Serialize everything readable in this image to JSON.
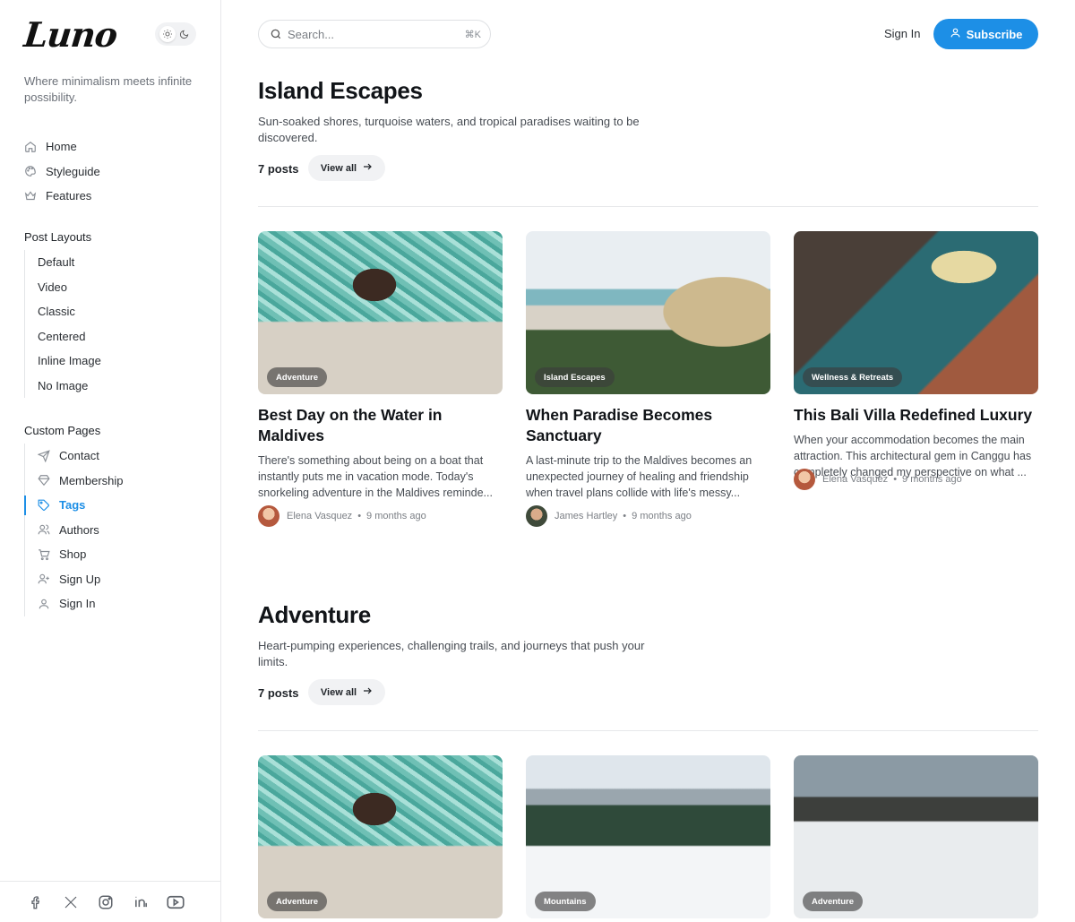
{
  "app": {
    "logo_text": "Luno",
    "tagline": "Where minimalism meets infinite possibility."
  },
  "sidebar": {
    "nav": [
      {
        "label": "Home",
        "icon": "home-icon"
      },
      {
        "label": "Styleguide",
        "icon": "palette-icon"
      },
      {
        "label": "Features",
        "icon": "crown-icon"
      }
    ],
    "post_layouts_heading": "Post Layouts",
    "post_layouts": [
      "Default",
      "Video",
      "Classic",
      "Centered",
      "Inline Image",
      "No Image"
    ],
    "custom_pages_heading": "Custom Pages",
    "custom_pages": [
      {
        "label": "Contact",
        "icon": "send-icon"
      },
      {
        "label": "Membership",
        "icon": "diamond-icon"
      },
      {
        "label": "Tags",
        "icon": "tag-icon",
        "active": true
      },
      {
        "label": "Authors",
        "icon": "users-icon"
      },
      {
        "label": "Shop",
        "icon": "cart-icon"
      },
      {
        "label": "Sign Up",
        "icon": "user-plus-icon"
      },
      {
        "label": "Sign In",
        "icon": "user-icon"
      }
    ],
    "social": [
      "facebook-icon",
      "x-icon",
      "instagram-icon",
      "linkedin-icon",
      "youtube-icon"
    ]
  },
  "header": {
    "search_placeholder": "Search...",
    "search_shortcut": "⌘K",
    "signin_label": "Sign In",
    "subscribe_label": "Subscribe"
  },
  "sections": [
    {
      "title": "Island Escapes",
      "description": "Sun-soaked shores, turquoise waters, and tropical paradises waiting to be discovered.",
      "posts_count": "7 posts",
      "view_all_label": "View all",
      "cards": [
        {
          "badge": "Adventure",
          "title": "Best Day on the Water in Maldives",
          "excerpt": "There's something about being on a boat that instantly puts me in vacation mode. Today's snorkeling adventure in the Maldives reminde...",
          "author": "Elena Vasquez",
          "time": "9 months ago"
        },
        {
          "badge": "Island Escapes",
          "title": "When Paradise Becomes Sanctuary",
          "excerpt": "A last-minute trip to the Maldives becomes an unexpected journey of healing and friendship when travel plans collide with life's messy...",
          "author": "James Hartley",
          "time": "9 months ago"
        },
        {
          "badge": "Wellness & Retreats",
          "title": "This Bali Villa Redefined Luxury",
          "excerpt": "When your accommodation becomes the main attraction. This architectural gem in Canggu has completely changed my perspective on what ...",
          "author": "Elena Vasquez",
          "time": "9 months ago"
        }
      ]
    },
    {
      "title": "Adventure",
      "description": "Heart-pumping experiences, challenging trails, and journeys that push your limits.",
      "posts_count": "7 posts",
      "view_all_label": "View all",
      "cards": [
        {
          "badge": "Adventure"
        },
        {
          "badge": "Mountains"
        },
        {
          "badge": "Adventure"
        }
      ]
    }
  ],
  "colors": {
    "accent": "#1d8fe6"
  }
}
